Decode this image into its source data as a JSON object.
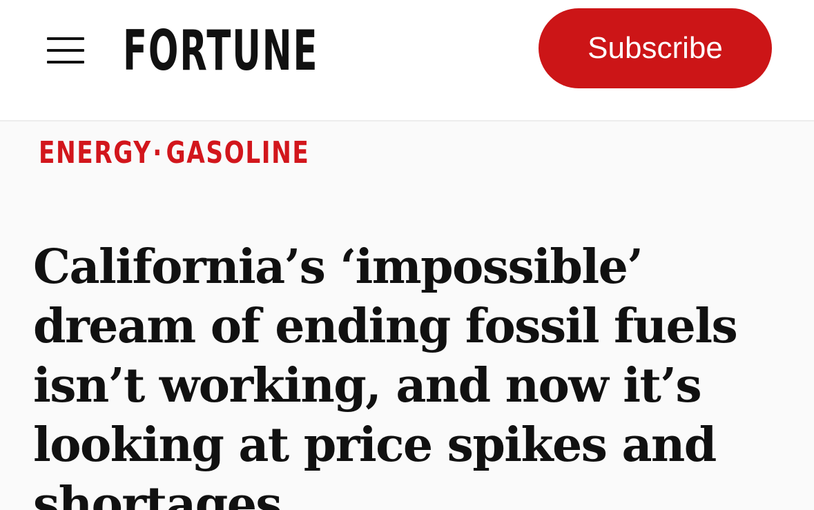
{
  "header": {
    "menu_icon": "hamburger-menu-icon",
    "logo": "FORTUNE",
    "subscribe_label": "Subscribe"
  },
  "article": {
    "sections": [
      "ENERGY",
      "GASOLINE"
    ],
    "separator": "·",
    "headline": "California’s ‘impossible’ dream of ending fossil fuels isn’t working, and now it’s looking at price spikes and shortages"
  },
  "colors": {
    "brand_red": "#cc1517",
    "section_red": "#d2161c",
    "text": "#111111",
    "header_bg": "#ffffff",
    "page_bg": "#fafafa"
  }
}
